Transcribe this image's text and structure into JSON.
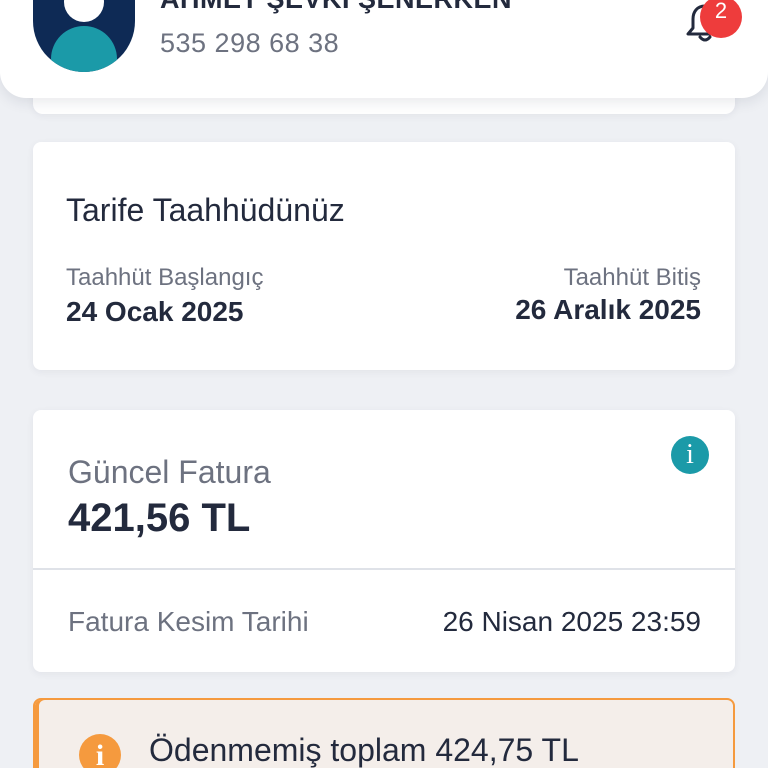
{
  "header": {
    "user_name": "AHMET ŞEVKİ ŞENERKEN",
    "phone": "535 298 68 38",
    "notification_count": "2"
  },
  "tariff": {
    "title": "Tarife Taahhüdünüz",
    "start_label": "Taahhüt Başlangıç",
    "start_date": "24 Ocak 2025",
    "end_label": "Taahhüt Bitiş",
    "end_date": "26 Aralık 2025"
  },
  "invoice": {
    "label": "Güncel Fatura",
    "amount": "421,56 TL",
    "info_glyph": "i",
    "cutoff_label": "Fatura Kesim Tarihi",
    "cutoff_date": "26 Nisan 2025 23:59"
  },
  "warning": {
    "glyph": "i",
    "text": "Ödenmemiş toplam 424,75 TL"
  },
  "colors": {
    "accent_teal": "#1b9aa8",
    "navy": "#0e2a55",
    "warning_orange": "#f59a3e",
    "badge_red": "#ee3c3c"
  },
  "icons": {
    "avatar": "user-avatar-icon",
    "bell": "bell-icon",
    "info": "info-icon",
    "warning": "warning-info-icon"
  }
}
